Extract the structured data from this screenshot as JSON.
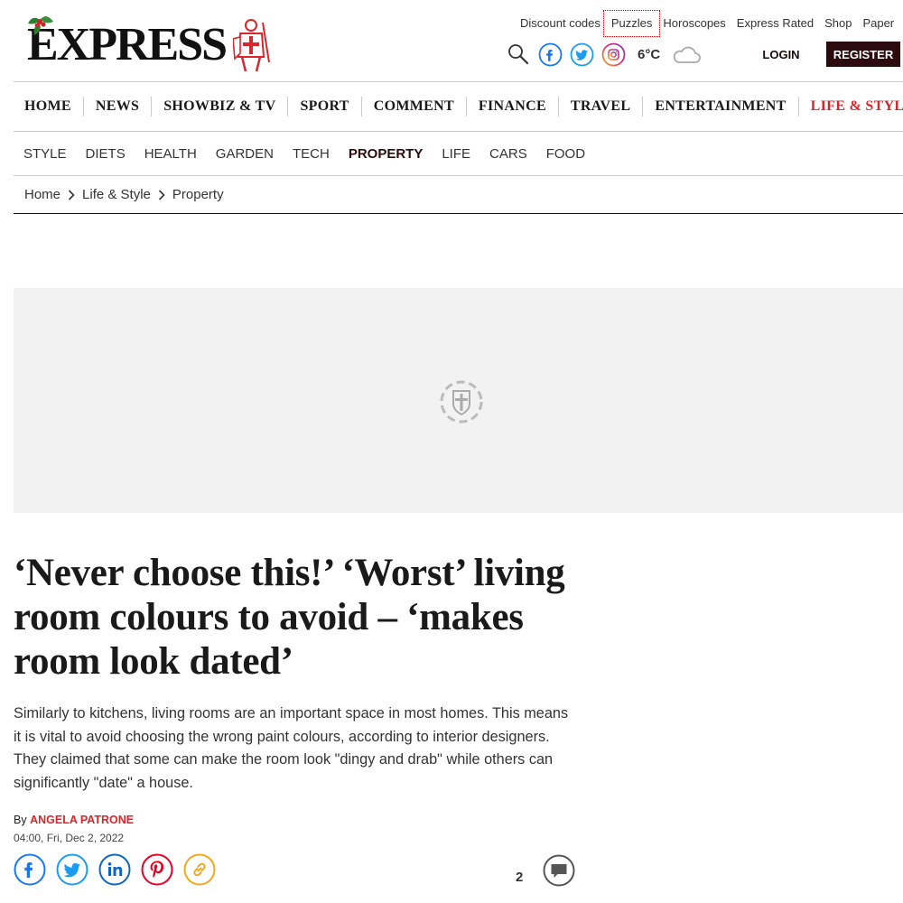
{
  "brand": {
    "name": "EXPRESS"
  },
  "toplinks": [
    "Discount codes",
    "Puzzles",
    "Horoscopes",
    "Express Rated",
    "Shop",
    "Paper"
  ],
  "weather": {
    "temperature": "6°C",
    "icon": "cloud-icon"
  },
  "account": {
    "login": "LOGIN",
    "register": "REGISTER"
  },
  "main_nav": [
    "HOME",
    "NEWS",
    "SHOWBIZ & TV",
    "SPORT",
    "COMMENT",
    "FINANCE",
    "TRAVEL",
    "ENTERTAINMENT",
    "LIFE & STYLE"
  ],
  "main_nav_active": "LIFE & STYLE",
  "sub_nav": [
    "STYLE",
    "DIETS",
    "HEALTH",
    "GARDEN",
    "TECH",
    "PROPERTY",
    "LIFE",
    "CARS",
    "FOOD"
  ],
  "sub_nav_active": "PROPERTY",
  "breadcrumb": [
    "Home",
    "Life & Style",
    "Property"
  ],
  "article": {
    "headline": "‘Never choose this!’ ‘Worst’ living room colours to avoid – ‘makes room look dated’",
    "standfirst": "Similarly to kitchens, living rooms are an important space in most homes. This means it is vital to avoid choosing the wrong paint colours, according to interior designers. They claimed that some can make the room look \"dingy and drab\" while others can significantly \"date\" a house.",
    "by": "By",
    "author": "ANGELA PATRONE",
    "date": "04:00, Fri, Dec 2, 2022",
    "comment_count": "2"
  },
  "colors": {
    "accent": "#d8262b",
    "dark": "#2b0b0d",
    "facebook": "#1877f2",
    "twitter": "#1d9bf0",
    "linkedin": "#0a66c2",
    "pinterest": "#e60023",
    "copy": "#f2a81d"
  }
}
